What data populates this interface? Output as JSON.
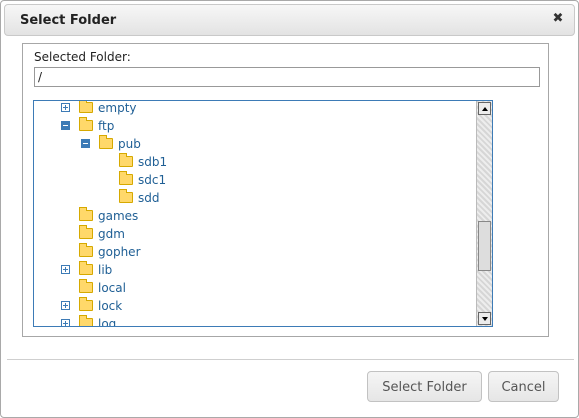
{
  "dialog": {
    "title": "Select Folder",
    "close_icon": "close-icon",
    "selected_folder_label": "Selected Folder:",
    "selected_folder_value": "/"
  },
  "tree": {
    "items": [
      {
        "label": "empty",
        "toggle": "plus",
        "depth": 0
      },
      {
        "label": "ftp",
        "toggle": "minus",
        "depth": 0
      },
      {
        "label": "pub",
        "toggle": "minus",
        "depth": 1
      },
      {
        "label": "sdb1",
        "toggle": "none",
        "depth": 2
      },
      {
        "label": "sdc1",
        "toggle": "none",
        "depth": 2
      },
      {
        "label": "sdd",
        "toggle": "none",
        "depth": 2
      },
      {
        "label": "games",
        "toggle": "none",
        "depth": 0
      },
      {
        "label": "gdm",
        "toggle": "none",
        "depth": 0
      },
      {
        "label": "gopher",
        "toggle": "none",
        "depth": 0
      },
      {
        "label": "lib",
        "toggle": "plus",
        "depth": 0
      },
      {
        "label": "local",
        "toggle": "none",
        "depth": 0
      },
      {
        "label": "lock",
        "toggle": "plus",
        "depth": 0
      },
      {
        "label": "log",
        "toggle": "plus",
        "depth": 0
      }
    ]
  },
  "buttons": {
    "select": "Select Folder",
    "cancel": "Cancel"
  },
  "colors": {
    "tree_text": "#1f5f95",
    "tree_border": "#3d7bb6",
    "folder": "#ffd86a"
  }
}
